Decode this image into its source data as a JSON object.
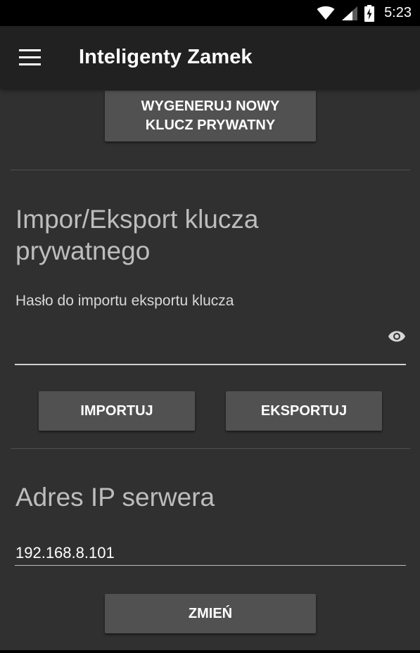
{
  "status_bar": {
    "time": "5:23",
    "icons": [
      "wifi-icon",
      "cell-signal-icon",
      "battery-charging-icon"
    ]
  },
  "app_bar": {
    "menu_icon": "hamburger-menu-icon",
    "title": "Inteligenty Zamek"
  },
  "keygen": {
    "button_label": "WYGENERUJ NOWY\nKLUCZ PRYWATNY"
  },
  "import_export": {
    "title": "Impor/Eksport klucza prywatnego",
    "password_label": "Hasło do importu eksportu klucza",
    "password_value": "",
    "visibility_icon": "eye-icon",
    "import_label": "IMPORTUJ",
    "export_label": "EKSPORTUJ"
  },
  "server": {
    "title": "Adres IP serwera",
    "ip_value": "192.168.8.101",
    "change_label": "ZMIEŃ"
  },
  "colors": {
    "background": "#303030",
    "app_bar": "#212121",
    "button": "#515151",
    "text_primary": "#ffffff",
    "text_secondary": "#bdbdbd"
  }
}
